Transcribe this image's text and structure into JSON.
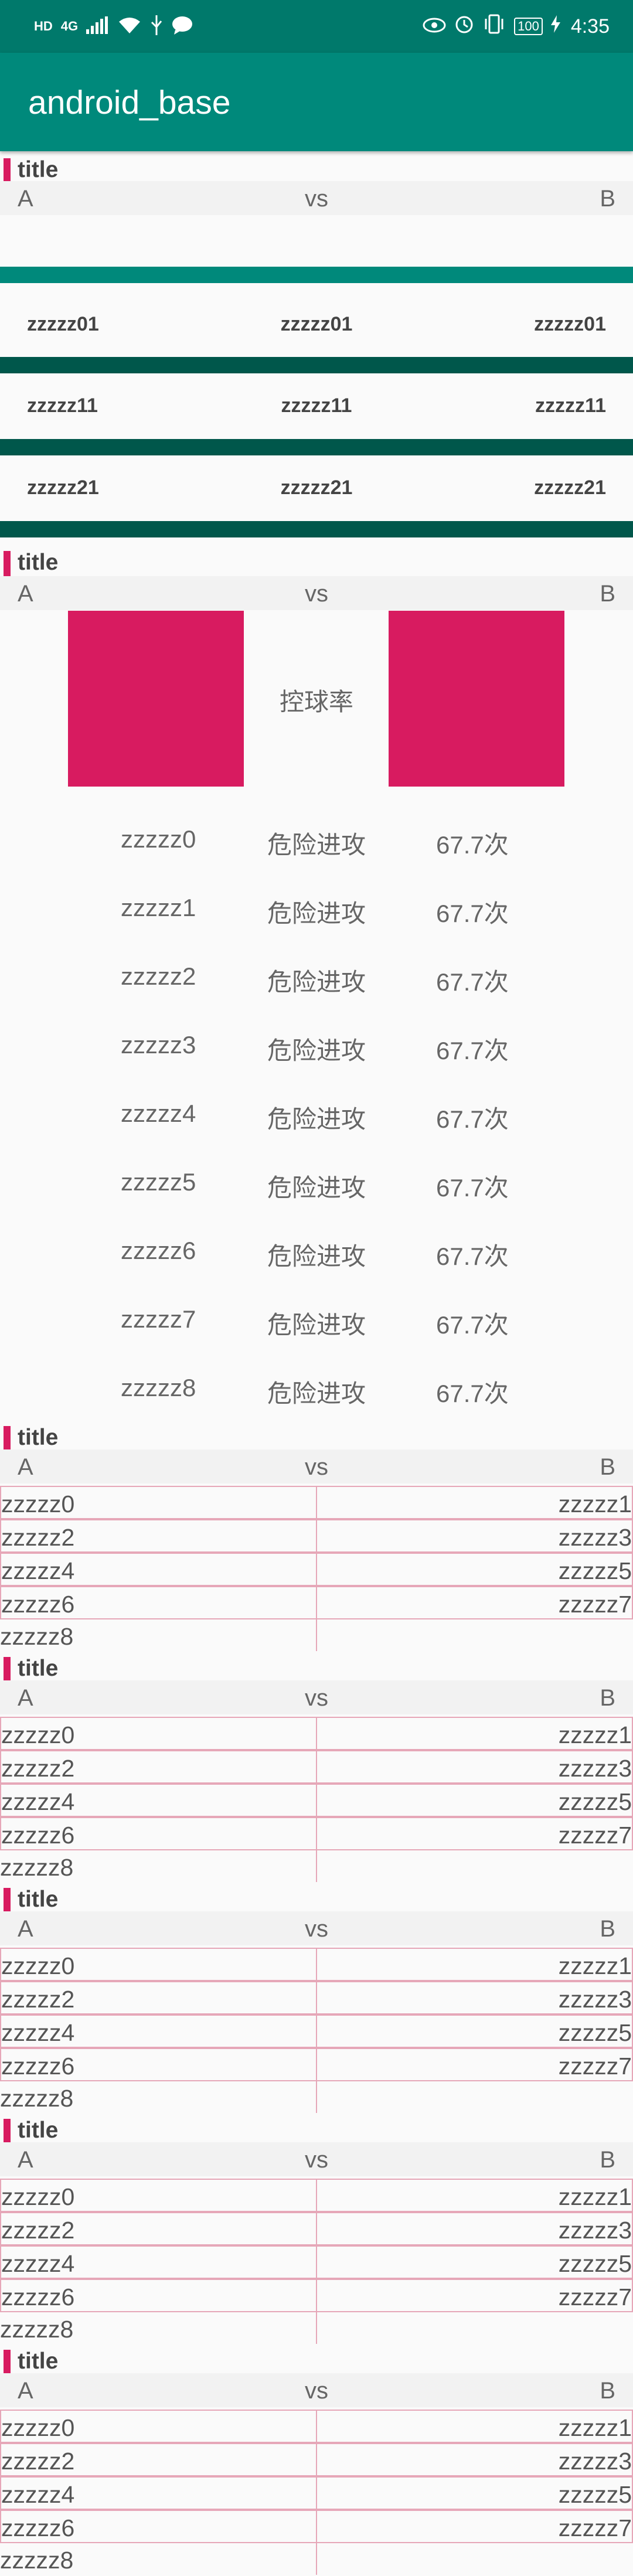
{
  "status_bar": {
    "left_text": "HD",
    "network": "4G",
    "battery": "100",
    "time": "4:35"
  },
  "app_bar": {
    "title": "android_base"
  },
  "header": {
    "a": "A",
    "vs": "vs",
    "b": "B"
  },
  "section_title": "title",
  "zz_rows": [
    [
      "zzzzz01",
      "zzzzz01",
      "zzzzz01"
    ],
    [
      "zzzzz11",
      "zzzzz11",
      "zzzzz11"
    ],
    [
      "zzzzz21",
      "zzzzz21",
      "zzzzz21"
    ]
  ],
  "possession_label": "控球率",
  "stats": [
    {
      "name": "zzzzz0",
      "label": "危险进攻",
      "value": "67.7次"
    },
    {
      "name": "zzzzz1",
      "label": "危险进攻",
      "value": "67.7次"
    },
    {
      "name": "zzzzz2",
      "label": "危险进攻",
      "value": "67.7次"
    },
    {
      "name": "zzzzz3",
      "label": "危险进攻",
      "value": "67.7次"
    },
    {
      "name": "zzzzz4",
      "label": "危险进攻",
      "value": "67.7次"
    },
    {
      "name": "zzzzz5",
      "label": "危险进攻",
      "value": "67.7次"
    },
    {
      "name": "zzzzz6",
      "label": "危险进攻",
      "value": "67.7次"
    },
    {
      "name": "zzzzz7",
      "label": "危险进攻",
      "value": "67.7次"
    },
    {
      "name": "zzzzz8",
      "label": "危险进攻",
      "value": "67.7次"
    }
  ],
  "grid_rows": [
    [
      "zzzzz0",
      "zzzzz1"
    ],
    [
      "zzzzz2",
      "zzzzz3"
    ],
    [
      "zzzzz4",
      "zzzzz5"
    ],
    [
      "zzzzz6",
      "zzzzz7"
    ],
    [
      "zzzzz8",
      ""
    ]
  ]
}
